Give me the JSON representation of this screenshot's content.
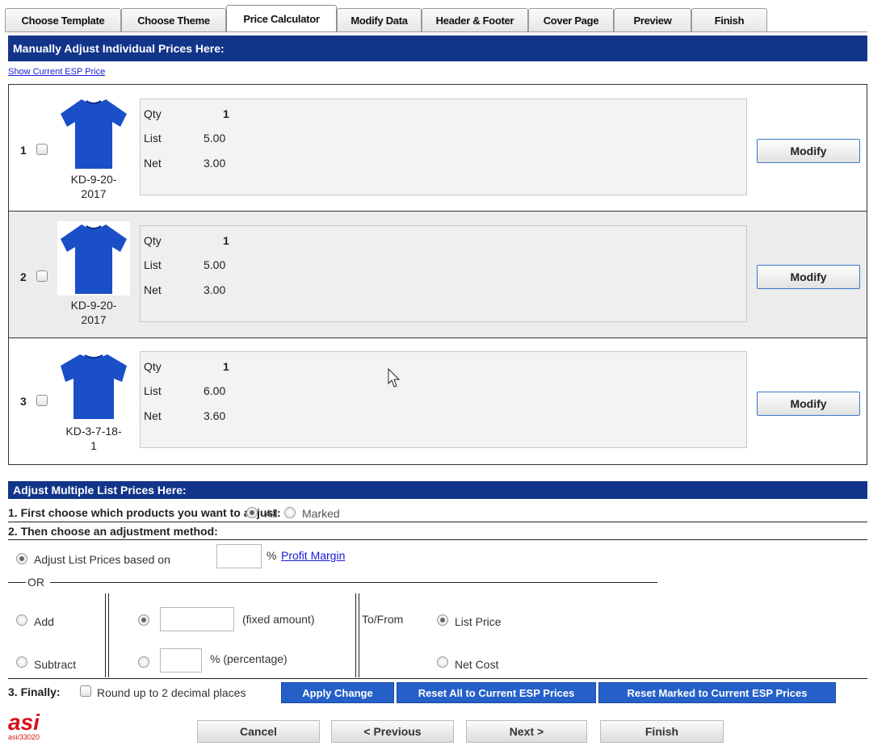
{
  "tabs": [
    {
      "label": "Choose Template"
    },
    {
      "label": "Choose Theme"
    },
    {
      "label": "Price Calculator"
    },
    {
      "label": "Modify Data"
    },
    {
      "label": "Header & Footer"
    },
    {
      "label": "Cover Page"
    },
    {
      "label": "Preview"
    },
    {
      "label": "Finish"
    }
  ],
  "active_tab": "Price Calculator",
  "manual": {
    "header": "Manually Adjust Individual Prices Here:",
    "show_link": "Show Current ESP Price",
    "qty_label": "Qty",
    "list_label": "List",
    "net_label": "Net",
    "modify_label": "Modify",
    "products": [
      {
        "num": "1",
        "sku_line1": "KD-9-20-",
        "sku_line2": "2017",
        "qty": "1",
        "list": "5.00",
        "net": "3.00"
      },
      {
        "num": "2",
        "sku_line1": "KD-9-20-",
        "sku_line2": "2017",
        "qty": "1",
        "list": "5.00",
        "net": "3.00"
      },
      {
        "num": "3",
        "sku_line1": "KD-3-7-18-",
        "sku_line2": "1",
        "qty": "1",
        "list": "6.00",
        "net": "3.60"
      }
    ]
  },
  "multi": {
    "header": "Adjust Multiple List Prices Here:",
    "step1": "1. First choose which products you want to adjust:",
    "opt_all": "All",
    "opt_marked": "Marked",
    "step2": "2. Then choose an adjustment method:",
    "based_on": "Adjust List Prices based on",
    "pct_sign": "%",
    "profit_margin": "Profit Margin",
    "or": "OR",
    "add": "Add",
    "subtract": "Subtract",
    "fixed_amount": "(fixed amount)",
    "percentage": "% (percentage)",
    "to_from": "To/From",
    "list_price": "List Price",
    "net_cost": "Net Cost",
    "step3": "3. Finally:",
    "round": "Round up to 2 decimal places",
    "apply": "Apply Change",
    "reset_all": "Reset All to Current ESP Prices",
    "reset_marked": "Reset Marked to Current ESP Prices"
  },
  "footer": {
    "logo": "asi",
    "logo_sub": "asi/33020",
    "cancel": "Cancel",
    "previous": "< Previous",
    "next": "Next >",
    "finish": "Finish"
  },
  "colors": {
    "header_blue": "#12358a",
    "button_blue": "#2560c8",
    "logo_red": "#d8101a",
    "shirt_blue": "#1a4fc8"
  }
}
